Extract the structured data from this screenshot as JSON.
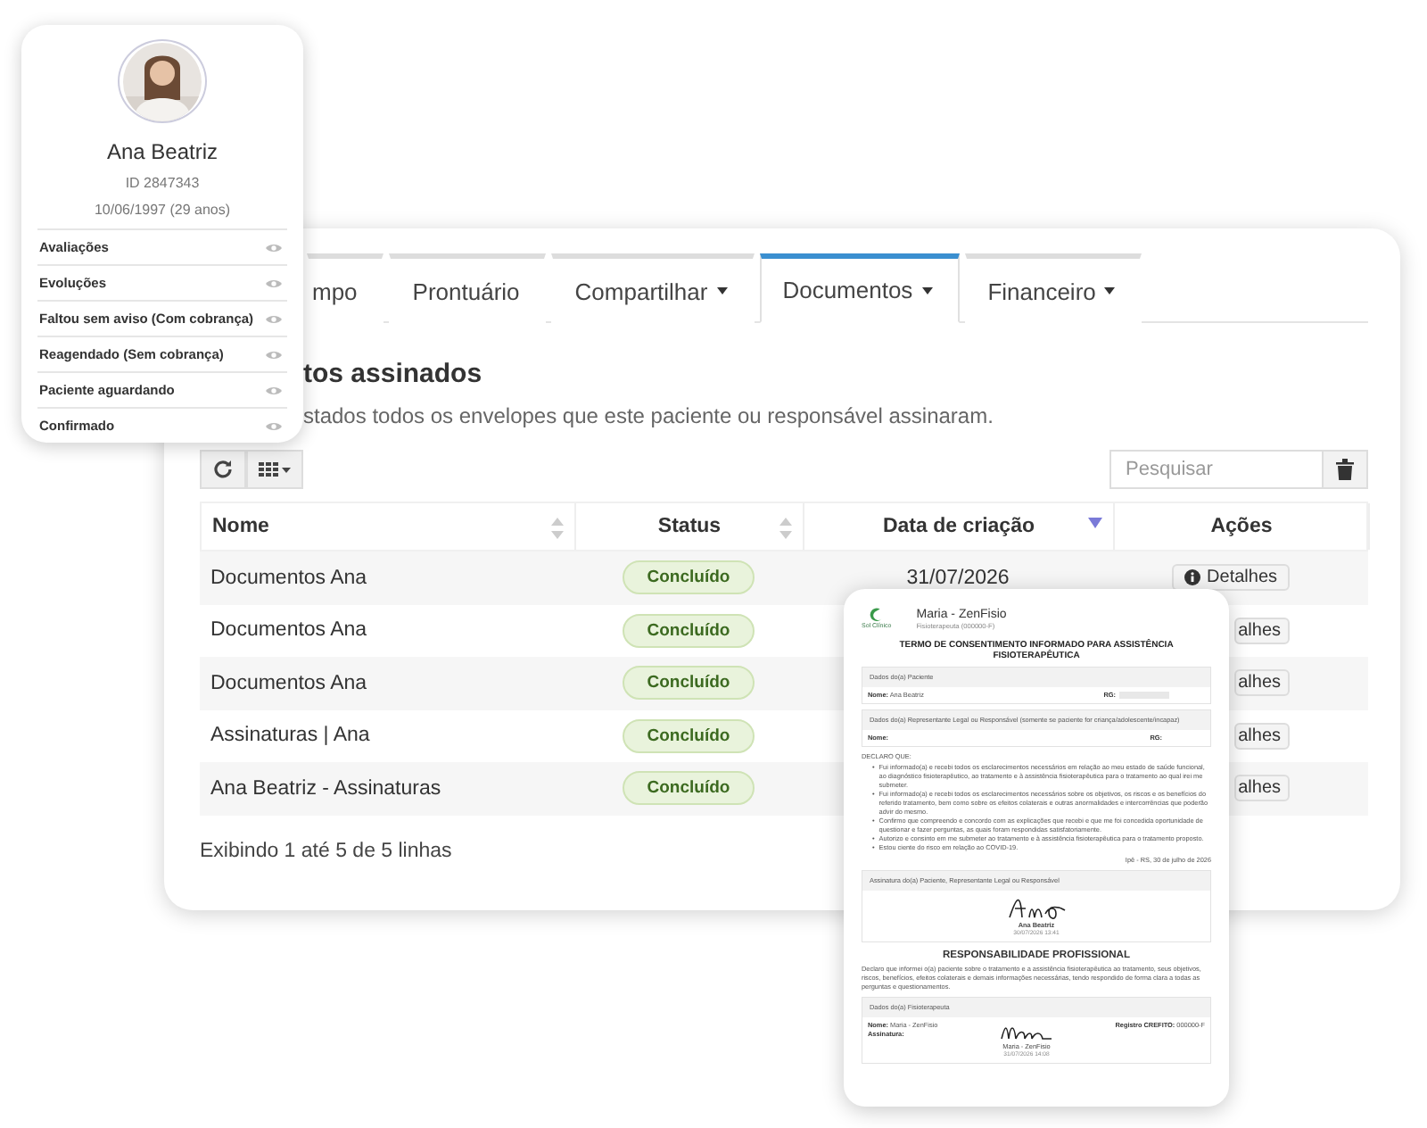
{
  "profile": {
    "name": "Ana Beatriz",
    "id": "ID 2847343",
    "birth": "10/06/1997 (29 anos)",
    "items": [
      {
        "label": "Avaliações"
      },
      {
        "label": "Evoluções"
      },
      {
        "label": "Faltou sem aviso (Com cobrança)"
      },
      {
        "label": "Reagendado (Sem cobrança)"
      },
      {
        "label": "Paciente aguardando"
      },
      {
        "label": "Confirmado"
      }
    ]
  },
  "main": {
    "tabs": [
      {
        "label": "mpo",
        "selected": false,
        "dropdown": false
      },
      {
        "label": "Prontuário",
        "selected": false,
        "dropdown": false
      },
      {
        "label": "Compartilhar",
        "selected": false,
        "dropdown": true
      },
      {
        "label": "Documentos",
        "selected": true,
        "dropdown": true
      },
      {
        "label": "Financeiro",
        "selected": false,
        "dropdown": true
      }
    ],
    "heading": "tos assinados",
    "subtitle": "stados todos os envelopes que este paciente ou responsável assinaram.",
    "search": {
      "placeholder": "Pesquisar"
    },
    "table": {
      "columns": [
        {
          "label": "Nome",
          "sortable": true,
          "sorted": false
        },
        {
          "label": "Status",
          "sortable": true,
          "sorted": false
        },
        {
          "label": "Data de criação",
          "sortable": true,
          "sorted": true
        },
        {
          "label": "Ações",
          "sortable": false,
          "sorted": false
        }
      ],
      "rows": [
        {
          "name": "Documentos Ana",
          "status": "Concluído",
          "date": "31/07/2026",
          "action": "Detalhes",
          "partial": false
        },
        {
          "name": "Documentos Ana",
          "status": "Concluído",
          "action": "alhes",
          "partial": true
        },
        {
          "name": "Documentos Ana",
          "status": "Concluído",
          "action": "alhes",
          "partial": true
        },
        {
          "name": "Assinaturas | Ana",
          "status": "Concluído",
          "action": "alhes",
          "partial": true
        },
        {
          "name": "Ana Beatriz - Assinaturas",
          "status": "Concluído",
          "action": "alhes",
          "partial": true
        }
      ]
    },
    "footer": "Exibindo 1 até 5 de 5 linhas"
  },
  "document": {
    "logo": "Sol Clínico",
    "author": "Maria - ZenFisio",
    "role": "Fisioterapeuta (000000-F)",
    "title": "TERMO DE CONSENTIMENTO INFORMADO PARA ASSISTÊNCIA FISIOTERAPÊUTICA",
    "patient_box": {
      "header": "Dados do(a) Paciente",
      "name_label": "Nome:",
      "name": "Ana Beatriz",
      "rg_label": "RG:"
    },
    "rep_box": {
      "header": "Dados do(a) Representante Legal ou Responsável (somente se paciente for criança/adolescente/incapaz)",
      "name_label": "Nome:",
      "rg_label": "RG:"
    },
    "declare": "DECLARO QUE:",
    "bullets": [
      {
        "marker": "•",
        "text": "Fui informado(a) e recebi todos os esclarecimentos necessários em relação ao meu estado de saúde funcional, ao diagnóstico fisioterapêutico, ao tratamento e à assistência fisioterapêutica para o tratamento ao qual irei me submeter."
      },
      {
        "marker": "•",
        "text": "Fui informado(a) e recebi todos os esclarecimentos necessários sobre os objetivos, os riscos e os benefícios do referido tratamento, bem como sobre os efeitos colaterais e outras anormalidades e intercorrências que poderão advir do mesmo."
      },
      {
        "marker": "•",
        "text": "Confirmo que compreendo e concordo com as explicações que recebi e que me foi concedida oportunidade de questionar e fazer perguntas, as quais foram respondidas satisfatoriamente."
      },
      {
        "marker": "•",
        "text": "Autorizo e consinto em me submeter ao tratamento e à assistência fisioterapêutica para o tratamento proposto."
      },
      {
        "marker": "•",
        "text": "Estou ciente do risco em relação ao COVID-19."
      }
    ],
    "place_date": "Ipê - RS, 30 de julho de 2026",
    "sign_box": {
      "header": "Assinatura do(a) Paciente, Representante Legal ou Responsável",
      "signer": "Ana Beatriz",
      "signed_at": "30/07/2026 13:41"
    },
    "resp_title": "RESPONSABILIDADE PROFISSIONAL",
    "resp_text": "Declaro que informei o(a) paciente sobre o tratamento e a assistência fisioterapêutica ao tratamento, seus objetivos, riscos, benefícios, efeitos colaterais e demais informações necessárias, tendo respondido de forma clara a todas as perguntas e questionamentos.",
    "pro_box": {
      "header": "Dados do(a) Fisioterapeuta",
      "name_label": "Nome:",
      "name": "Maria - ZenFisio",
      "sign_label": "Assinatura:",
      "signer": "Maria - ZenFisio",
      "signed_at": "31/07/2026 14:08",
      "reg_label": "Registro CREFITO:",
      "reg": "000000-F"
    }
  }
}
